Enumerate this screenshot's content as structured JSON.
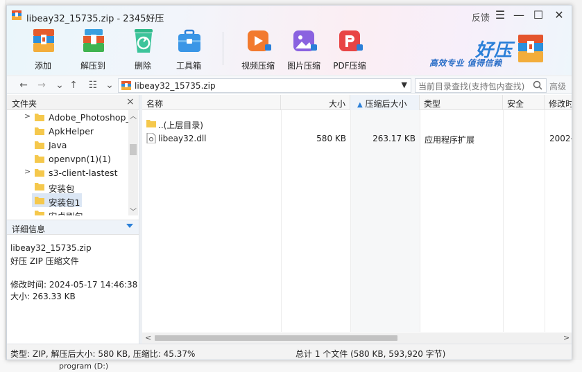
{
  "window": {
    "title": "libeay32_15735.zip - 2345好压",
    "feedback_label": "反馈",
    "menu_icon": "hamburger-icon",
    "minimize_icon": "minimize-icon",
    "maximize_icon": "maximize-icon",
    "close_icon": "close-icon"
  },
  "toolbar": {
    "items": [
      {
        "label": "添加",
        "icon": "add-archive-icon"
      },
      {
        "label": "解压到",
        "icon": "extract-icon"
      },
      {
        "label": "删除",
        "icon": "recycle-icon"
      },
      {
        "label": "工具箱",
        "icon": "toolbox-icon"
      },
      {
        "label": "视频压缩",
        "icon": "video-compress-icon"
      },
      {
        "label": "图片压缩",
        "icon": "image-compress-icon"
      },
      {
        "label": "PDF压缩",
        "icon": "pdf-compress-icon"
      }
    ]
  },
  "brand": {
    "name": "好压",
    "slogan": "高效专业 值得信赖"
  },
  "nav": {
    "path": "libeay32_15735.zip",
    "search_placeholder": "当前目录查找(支持包内查找)",
    "advanced_label": "高级"
  },
  "tree": {
    "header": "文件夹",
    "items": [
      {
        "name": "Adobe_Photoshop_",
        "expandable": true,
        "selected": false
      },
      {
        "name": "ApkHelper",
        "expandable": false,
        "selected": false
      },
      {
        "name": "Java",
        "expandable": false,
        "selected": false
      },
      {
        "name": "openvpn(1)(1)",
        "expandable": false,
        "selected": false
      },
      {
        "name": "s3-client-lastest",
        "expandable": true,
        "selected": false
      },
      {
        "name": "安装包",
        "expandable": false,
        "selected": false
      },
      {
        "name": "安装包1",
        "expandable": false,
        "selected": true
      },
      {
        "name": "安卓刷包",
        "expandable": false,
        "selected": false
      }
    ]
  },
  "details": {
    "header": "详细信息",
    "filename": "libeay32_15735.zip",
    "filetype": "好压 ZIP 压缩文件",
    "modified": "修改时间: 2024-05-17 14:46:38",
    "size": "大小: 263.33 KB"
  },
  "list": {
    "columns": {
      "name": "名称",
      "size": "大小",
      "packed": "压缩后大小",
      "type": "类型",
      "security": "安全",
      "modified": "修改时"
    },
    "rows": [
      {
        "name": "..(上层目录)",
        "size": "",
        "packed": "",
        "type": "",
        "modified": "",
        "icon": "folder-icon"
      },
      {
        "name": "libeay32.dll",
        "size": "580 KB",
        "packed": "263.17 KB",
        "type": "应用程序扩展",
        "modified": "2002-",
        "icon": "dll-file-icon"
      }
    ]
  },
  "status": {
    "left": "类型: ZIP, 解压后大小: 580 KB, 压缩比: 45.37%",
    "right": "总计 1 个文件 (580 KB, 593,920 字节)"
  },
  "background": {
    "peek_text": "program (D:)"
  }
}
